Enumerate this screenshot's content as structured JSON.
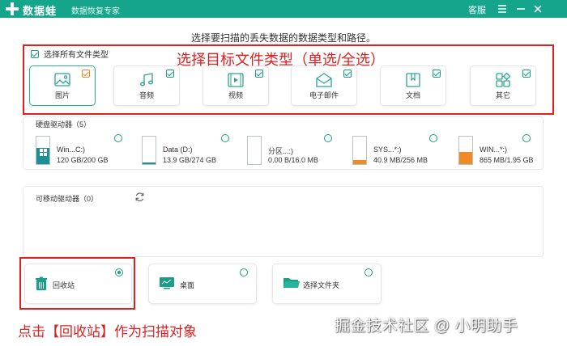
{
  "app": {
    "name": "数据蛙",
    "subtitle": "数据恢复专家",
    "service": "客服"
  },
  "colors": {
    "accent": "#14a58c",
    "annotation": "#e02020",
    "orange": "#f08a24"
  },
  "prompt": "选择要扫描的丢失数据的数据类型和路径。",
  "file_types": {
    "select_all_label": "选择所有文件类型",
    "items": [
      {
        "label": "图片",
        "icon": "image-icon",
        "checked": true,
        "active": true
      },
      {
        "label": "音频",
        "icon": "music-icon",
        "checked": true
      },
      {
        "label": "视频",
        "icon": "video-icon",
        "checked": true
      },
      {
        "label": "电子邮件",
        "icon": "mail-icon",
        "checked": true
      },
      {
        "label": "文档",
        "icon": "document-icon",
        "checked": true
      },
      {
        "label": "其它",
        "icon": "other-icon",
        "checked": true
      }
    ]
  },
  "drives": {
    "title": "硬盘驱动器（5）",
    "items": [
      {
        "name": "Win...C:)",
        "size": "120 GB/200 GB",
        "fill": 0.6
      },
      {
        "name": "Data (D:)",
        "size": "13.9 GB/274 GB",
        "fill": 0.05
      },
      {
        "name": "分区...:)",
        "size": "0.00  B/16.0 MB",
        "fill": 0.0
      },
      {
        "name": "SYS...*:)",
        "size": "40.9 MB/256 MB",
        "fill": 0.16
      },
      {
        "name": "WIN...*:)",
        "size": "865 MB/1.95 GB",
        "fill": 0.44
      }
    ]
  },
  "removable": {
    "title": "可移动驱动器（0）"
  },
  "locations": [
    {
      "label": "回收站",
      "icon": "recycle-bin-icon",
      "selected": true
    },
    {
      "label": "桌面",
      "icon": "desktop-icon",
      "selected": false
    },
    {
      "label": "选择文件夹",
      "icon": "folder-icon",
      "selected": false
    }
  ],
  "annotations": {
    "types": "选择目标文件类型（单选/全选）",
    "recycle": "点击【回收站】作为扫描对象"
  },
  "watermark": "掘金技术社区 @ 小明助手"
}
